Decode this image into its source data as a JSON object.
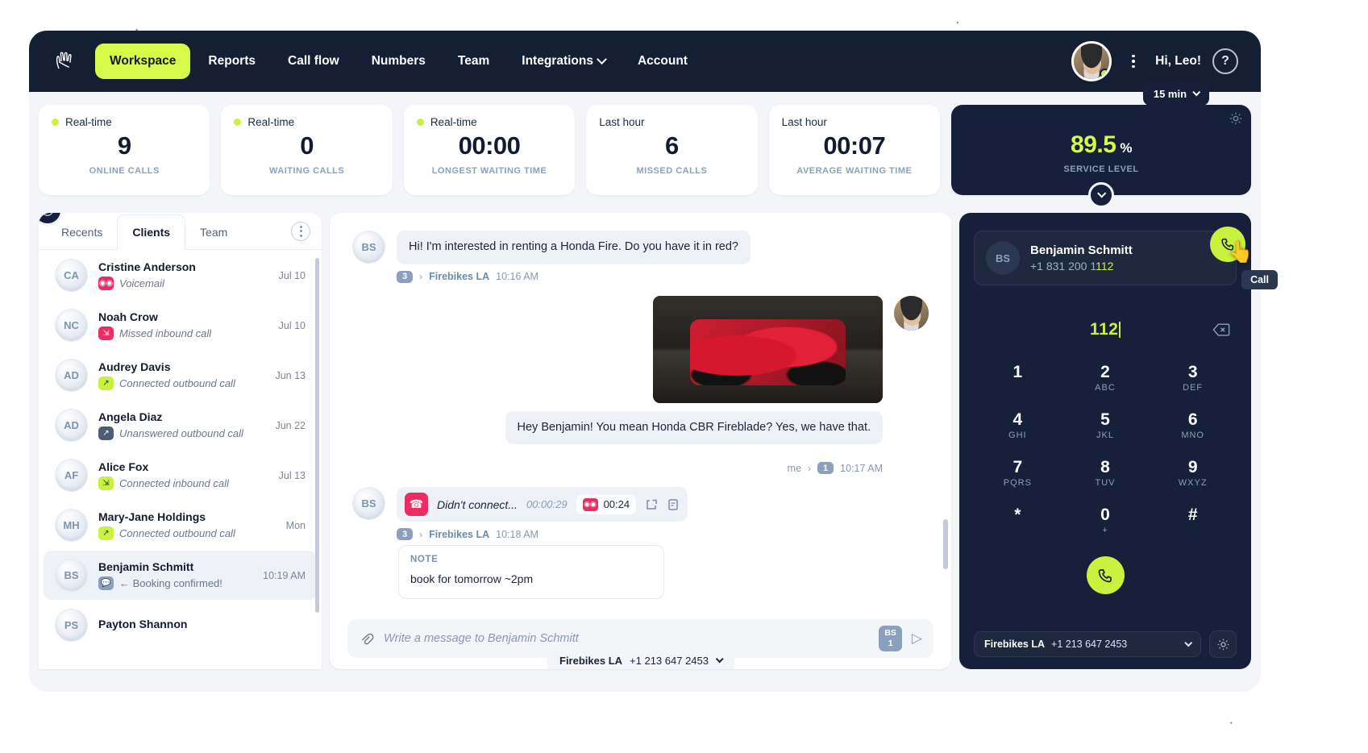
{
  "nav": {
    "logo_icon": "hand-logo-icon",
    "items": [
      {
        "label": "Workspace",
        "active": true
      },
      {
        "label": "Reports",
        "active": false
      },
      {
        "label": "Call flow",
        "active": false
      },
      {
        "label": "Numbers",
        "active": false
      },
      {
        "label": "Integrations",
        "active": false,
        "has_chevron": true
      },
      {
        "label": "Account",
        "active": false
      }
    ],
    "greeting": "Hi, Leo!",
    "help_label": "?"
  },
  "stats": {
    "cards": [
      {
        "period": "Real-time",
        "live": true,
        "value": "9",
        "label": "ONLINE CALLS"
      },
      {
        "period": "Real-time",
        "live": true,
        "value": "0",
        "label": "WAITING CALLS"
      },
      {
        "period": "Real-time",
        "live": true,
        "value": "00:00",
        "label": "LONGEST WAITING TIME"
      },
      {
        "period": "Last hour",
        "live": false,
        "value": "6",
        "label": "MISSED CALLS"
      },
      {
        "period": "Last hour",
        "live": false,
        "value": "00:07",
        "label": "AVERAGE WAITING TIME"
      }
    ],
    "service_level": {
      "period_selector": "15 min",
      "value": "89.5",
      "unit": "%",
      "label": "SERVICE LEVEL"
    }
  },
  "contacts": {
    "tabs": [
      {
        "label": "Recents",
        "active": false
      },
      {
        "label": "Clients",
        "active": true
      },
      {
        "label": "Team",
        "active": false
      }
    ],
    "items": [
      {
        "initials": "CA",
        "name": "Cristine Anderson",
        "status": "Voicemail",
        "badge": "voicemail-icon",
        "badge_color": "pink",
        "time": "Jul 10",
        "selected": false
      },
      {
        "initials": "NC",
        "name": "Noah Crow",
        "status": "Missed inbound call",
        "badge": "inbound-arrow-icon",
        "badge_color": "pink",
        "time": "Jul 10",
        "selected": false
      },
      {
        "initials": "AD",
        "name": "Audrey Davis",
        "status": "Connected outbound call",
        "badge": "outbound-arrow-icon",
        "badge_color": "lime",
        "time": "Jun 13",
        "selected": false
      },
      {
        "initials": "AD",
        "name": "Angela Diaz",
        "status": "Unanswered outbound call",
        "badge": "outbound-arrow-icon",
        "badge_color": "slate",
        "time": "Jun 22",
        "selected": false
      },
      {
        "initials": "AF",
        "name": "Alice Fox",
        "status": "Connected inbound call",
        "badge": "inbound-arrow-icon",
        "badge_color": "lime",
        "time": "Jul 13",
        "selected": false
      },
      {
        "initials": "MH",
        "name": "Mary-Jane Holdings",
        "status": "Connected outbound call",
        "badge": "outbound-arrow-icon",
        "badge_color": "lime",
        "time": "Mon",
        "selected": false
      },
      {
        "initials": "BS",
        "name": "Benjamin Schmitt",
        "status": "← Booking confirmed!",
        "badge": "message-icon",
        "badge_color": "steel",
        "time": "10:19 AM",
        "selected": true
      },
      {
        "initials": "PS",
        "name": "Payton Shannon",
        "status": "",
        "badge": "",
        "badge_color": "steel",
        "time": "",
        "selected": false
      }
    ]
  },
  "chat": {
    "messages": [
      {
        "type": "text",
        "direction": "in",
        "initials": "BS",
        "text": "Hi! I'm interested in renting a Honda Fire. Do you have it in red?",
        "meta_count": "3",
        "meta_channel": "Firebikes LA",
        "meta_time": "10:16 AM"
      },
      {
        "type": "image",
        "direction": "out",
        "alt": "red-motorcycle-photo"
      },
      {
        "type": "text",
        "direction": "out",
        "text": "Hey Benjamin! You mean Honda CBR Fireblade? Yes, we have that.",
        "meta_me": "me",
        "meta_count": "1",
        "meta_time": "10:17 AM"
      },
      {
        "type": "call",
        "direction": "in",
        "initials": "BS",
        "call_text": "Didn't connect...",
        "call_duration": "00:00:29",
        "voicemail_duration": "00:24",
        "meta_count": "3",
        "meta_channel": "Firebikes LA",
        "meta_time": "10:18 AM"
      }
    ],
    "note": {
      "header": "NOTE",
      "body": "book for tomorrow ~2pm"
    },
    "composer": {
      "placeholder": "Write a message to Benjamin Schmitt",
      "value": "",
      "sender_initials": "BS",
      "sender_count": "1",
      "from_label": "Firebikes LA",
      "from_number": "+1 213 647 2453"
    }
  },
  "dialpad": {
    "contact": {
      "initials": "BS",
      "name": "Benjamin Schmitt",
      "number_prefix": "+1 831 200 1",
      "number_highlight": "112"
    },
    "call_tooltip": "Call",
    "display": "112",
    "keys": [
      {
        "digit": "1",
        "letters": ""
      },
      {
        "digit": "2",
        "letters": "ABC"
      },
      {
        "digit": "3",
        "letters": "DEF"
      },
      {
        "digit": "4",
        "letters": "GHI"
      },
      {
        "digit": "5",
        "letters": "JKL"
      },
      {
        "digit": "6",
        "letters": "MNO"
      },
      {
        "digit": "7",
        "letters": "PQRS"
      },
      {
        "digit": "8",
        "letters": "TUV"
      },
      {
        "digit": "9",
        "letters": "WXYZ"
      },
      {
        "digit": "*",
        "letters": ""
      },
      {
        "digit": "0",
        "letters": "+"
      },
      {
        "digit": "#",
        "letters": ""
      }
    ],
    "from_label": "Firebikes LA",
    "from_number": "+1 213 647 2453"
  },
  "colors": {
    "accent_lime": "#c7f33f",
    "dark_navy": "#16203a",
    "pink": "#ec2d62",
    "muted_blue": "#8ba0bc"
  }
}
